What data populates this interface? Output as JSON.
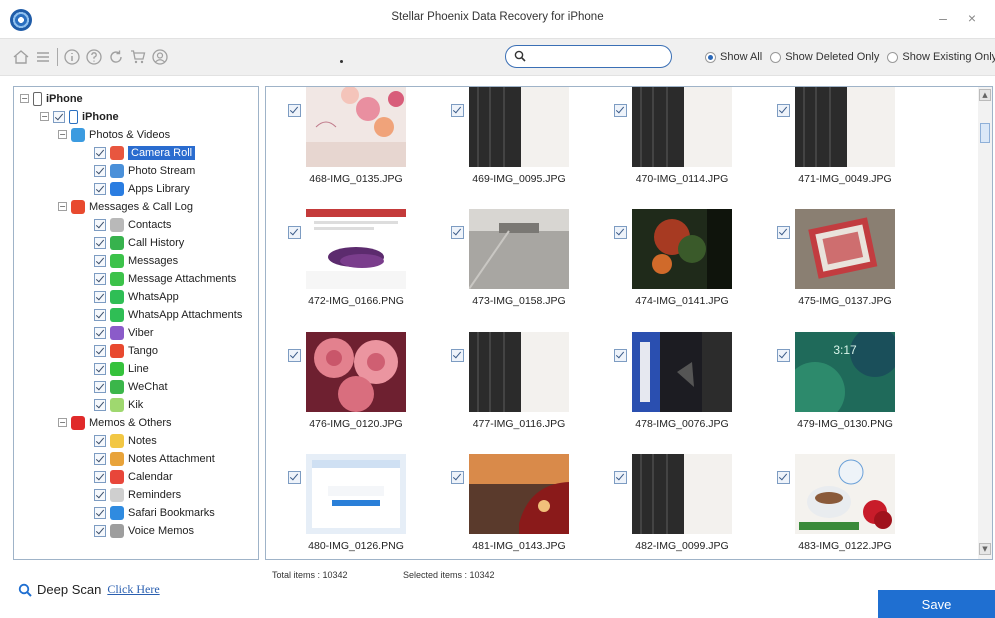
{
  "window": {
    "title": "Stellar Phoenix Data Recovery for iPhone",
    "minimize": "–",
    "close": "×"
  },
  "toolbar": {
    "icons": [
      "home-icon",
      "menu-icon",
      "info-icon",
      "help-icon",
      "refresh-icon",
      "cart-icon",
      "user-icon"
    ],
    "search_value": "",
    "filters": [
      {
        "label": "Show All",
        "selected": true
      },
      {
        "label": "Show Deleted Only",
        "selected": false
      },
      {
        "label": "Show Existing Only",
        "selected": false
      }
    ]
  },
  "tree": {
    "root": "iPhone",
    "device": "iPhone",
    "groups": [
      {
        "label": "Photos & Videos",
        "icon_color": "#3b9be0",
        "items": [
          {
            "label": "Camera Roll",
            "selected": true,
            "icon_color": "#e8563f"
          },
          {
            "label": "Photo Stream",
            "icon_color": "#4a90d9"
          },
          {
            "label": "Apps Library",
            "icon_color": "#2a7de1"
          }
        ]
      },
      {
        "label": "Messages & Call Log",
        "icon_color": "#e84a2f",
        "items": [
          {
            "label": "Contacts",
            "icon_color": "#b9b9b9"
          },
          {
            "label": "Call History",
            "icon_color": "#37b24d"
          },
          {
            "label": "Messages",
            "icon_color": "#3cc24a"
          },
          {
            "label": "Message Attachments",
            "icon_color": "#3cc24a"
          },
          {
            "label": "WhatsApp",
            "icon_color": "#2fbe55"
          },
          {
            "label": "WhatsApp Attachments",
            "icon_color": "#2fbe55"
          },
          {
            "label": "Viber",
            "icon_color": "#8b5bc9"
          },
          {
            "label": "Tango",
            "icon_color": "#e8492f"
          },
          {
            "label": "Line",
            "icon_color": "#35c23c"
          },
          {
            "label": "WeChat",
            "icon_color": "#3bb64a"
          },
          {
            "label": "Kik",
            "icon_color": "#9fd86f"
          }
        ]
      },
      {
        "label": "Memos & Others",
        "icon_color": "#e02a2a",
        "items": [
          {
            "label": "Notes",
            "icon_color": "#f2c744"
          },
          {
            "label": "Notes Attachment",
            "icon_color": "#e8a33a"
          },
          {
            "label": "Calendar",
            "icon_color": "#e8463a"
          },
          {
            "label": "Reminders",
            "icon_color": "#cfcfcf"
          },
          {
            "label": "Safari Bookmarks",
            "icon_color": "#2f8be0"
          },
          {
            "label": "Voice Memos",
            "icon_color": "#9e9e9e"
          }
        ]
      }
    ]
  },
  "files": [
    {
      "name": "468-IMG_0135.JPG",
      "thumb": "flowers-pink"
    },
    {
      "name": "469-IMG_0095.JPG",
      "thumb": "dark-frame"
    },
    {
      "name": "470-IMG_0114.JPG",
      "thumb": "dark-frame"
    },
    {
      "name": "471-IMG_0049.JPG",
      "thumb": "dark-frame"
    },
    {
      "name": "472-IMG_0166.PNG",
      "thumb": "screenshot-eggplant"
    },
    {
      "name": "473-IMG_0158.JPG",
      "thumb": "office-floor"
    },
    {
      "name": "474-IMG_0141.JPG",
      "thumb": "dark-red-green"
    },
    {
      "name": "475-IMG_0137.JPG",
      "thumb": "playing-card"
    },
    {
      "name": "476-IMG_0120.JPG",
      "thumb": "pink-roses"
    },
    {
      "name": "477-IMG_0116.JPG",
      "thumb": "dark-frame"
    },
    {
      "name": "478-IMG_0076.JPG",
      "thumb": "dark-blue"
    },
    {
      "name": "479-IMG_0130.PNG",
      "thumb": "ios-lockscreen"
    },
    {
      "name": "480-IMG_0126.PNG",
      "thumb": "web-screenshot"
    },
    {
      "name": "481-IMG_0143.JPG",
      "thumb": "red-car-sunset"
    },
    {
      "name": "482-IMG_0099.JPG",
      "thumb": "dark-frame"
    },
    {
      "name": "483-IMG_0122.JPG",
      "thumb": "coffee-card"
    }
  ],
  "footer": {
    "deep_scan_label": "Deep Scan",
    "click_here": "Click Here",
    "total_items": "Total items : 10342",
    "selected_items": "Selected items : 10342",
    "save_label": "Save"
  }
}
